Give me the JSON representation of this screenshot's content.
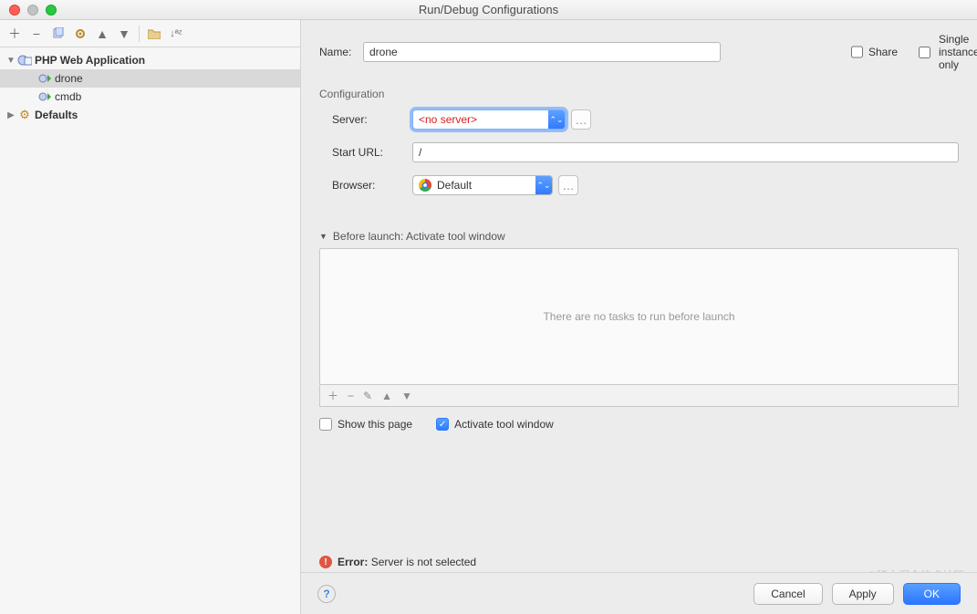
{
  "window": {
    "title": "Run/Debug Configurations"
  },
  "tree": {
    "root_label": "PHP Web Application",
    "items": [
      {
        "label": "drone",
        "selected": true
      },
      {
        "label": "cmdb",
        "selected": false
      }
    ],
    "defaults_label": "Defaults"
  },
  "form": {
    "name_label": "Name:",
    "name_value": "drone",
    "share_label": "Share",
    "single_instance_label": "Single instance only",
    "config_section": "Configuration",
    "server_label": "Server:",
    "server_value": "<no server>",
    "starturl_label": "Start URL:",
    "starturl_value": "/",
    "browser_label": "Browser:",
    "browser_value": "Default"
  },
  "before": {
    "header": "Before launch: Activate tool window",
    "empty_text": "There are no tasks to run before launch"
  },
  "checks": {
    "show_this_page": "Show this page",
    "activate_tool_window": "Activate tool window"
  },
  "error": {
    "label": "Error:",
    "msg": "Server is not selected"
  },
  "buttons": {
    "cancel": "Cancel",
    "apply": "Apply",
    "ok": "OK"
  },
  "watermark": "@稀土掘金技术社区"
}
